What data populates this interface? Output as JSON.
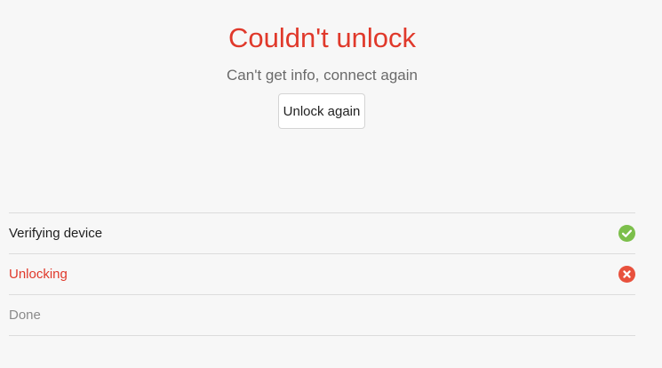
{
  "header": {
    "title": "Couldn't unlock",
    "message": "Can't get info, connect again",
    "retry_label": "Unlock again"
  },
  "steps": [
    {
      "label": "Verifying device",
      "status": "success",
      "icon": "check-circle-icon"
    },
    {
      "label": "Unlocking",
      "status": "error",
      "icon": "error-circle-icon"
    },
    {
      "label": "Done",
      "status": "pending",
      "icon": null
    }
  ],
  "colors": {
    "error": "#e0392b",
    "success": "#7cbf4b",
    "error_icon": "#e8513d",
    "muted": "#8a8a8a"
  }
}
